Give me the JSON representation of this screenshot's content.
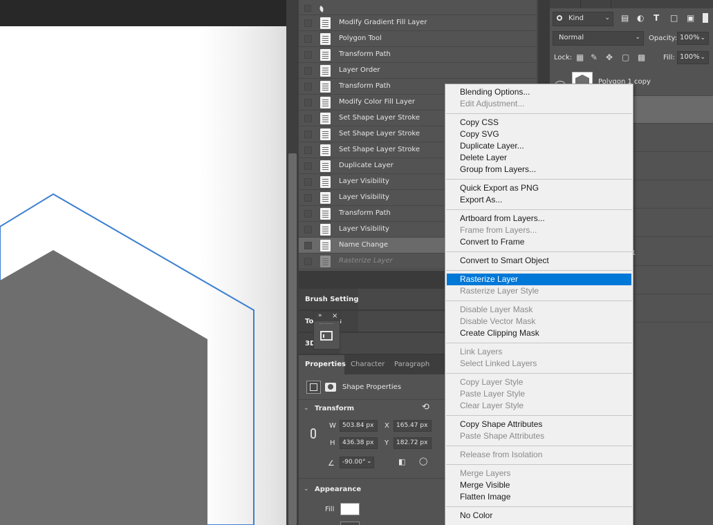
{
  "history": {
    "items": [
      {
        "label": "Modify Gradient Fill Layer"
      },
      {
        "label": "Polygon Tool"
      },
      {
        "label": "Transform Path"
      },
      {
        "label": "Layer Order"
      },
      {
        "label": "Transform Path"
      },
      {
        "label": "Modify Color Fill Layer"
      },
      {
        "label": "Set Shape Layer Stroke"
      },
      {
        "label": "Set Shape Layer Stroke"
      },
      {
        "label": "Set Shape Layer Stroke"
      },
      {
        "label": "Duplicate Layer"
      },
      {
        "label": "Layer Visibility"
      },
      {
        "label": "Layer Visibility"
      },
      {
        "label": "Transform Path"
      },
      {
        "label": "Layer Visibility"
      },
      {
        "label": "Name Change"
      },
      {
        "label": "Rasterize Layer"
      }
    ],
    "selected_index": 14,
    "undone_index": 15
  },
  "panels": {
    "brush_settings": "Brush Settings",
    "tool_presets_partial": "To",
    "tool_presets_tail": "s",
    "three_d": "3D"
  },
  "floating_panel": {
    "expand": "»",
    "close": "×"
  },
  "properties": {
    "tabs": [
      "Properties",
      "Character",
      "Paragraph"
    ],
    "active_tab": "Properties",
    "shape_label": "Shape Properties",
    "transform_title": "Transform",
    "w_label": "W",
    "w_value": "503.84 px",
    "x_label": "X",
    "x_value": "165.47 px",
    "h_label": "H",
    "h_value": "436.38 px",
    "y_label": "Y",
    "y_value": "182.72 px",
    "angle_value": "-90.00°",
    "appearance_title": "Appearance",
    "fill_label": "Fill",
    "fill_color": "#ffffff"
  },
  "layers": {
    "kind_label": "Kind",
    "blend_mode": "Normal",
    "opacity_label": "Opacity:",
    "opacity_value": "100%",
    "lock_label": "Lock:",
    "fill_label": "Fill:",
    "fill_value": "100%",
    "top_layer_name": "Polygon 1 copy",
    "partial_layer_text": "1"
  },
  "context_menu": {
    "groups": [
      [
        {
          "label": "Blending Options...",
          "enabled": true
        },
        {
          "label": "Edit Adjustment...",
          "enabled": false
        }
      ],
      [
        {
          "label": "Copy CSS",
          "enabled": true
        },
        {
          "label": "Copy SVG",
          "enabled": true
        },
        {
          "label": "Duplicate Layer...",
          "enabled": true
        },
        {
          "label": "Delete Layer",
          "enabled": true
        },
        {
          "label": "Group from Layers...",
          "enabled": true
        }
      ],
      [
        {
          "label": "Quick Export as PNG",
          "enabled": true
        },
        {
          "label": "Export As...",
          "enabled": true
        }
      ],
      [
        {
          "label": "Artboard from Layers...",
          "enabled": true
        },
        {
          "label": "Frame from Layers...",
          "enabled": false
        },
        {
          "label": "Convert to Frame",
          "enabled": true
        }
      ],
      [
        {
          "label": "Convert to Smart Object",
          "enabled": true
        }
      ],
      [
        {
          "label": "Rasterize Layer",
          "enabled": true,
          "highlighted": true
        },
        {
          "label": "Rasterize Layer Style",
          "enabled": false
        }
      ],
      [
        {
          "label": "Disable Layer Mask",
          "enabled": false
        },
        {
          "label": "Disable Vector Mask",
          "enabled": false
        },
        {
          "label": "Create Clipping Mask",
          "enabled": true
        }
      ],
      [
        {
          "label": "Link Layers",
          "enabled": false
        },
        {
          "label": "Select Linked Layers",
          "enabled": false
        }
      ],
      [
        {
          "label": "Copy Layer Style",
          "enabled": false
        },
        {
          "label": "Paste Layer Style",
          "enabled": false
        },
        {
          "label": "Clear Layer Style",
          "enabled": false
        }
      ],
      [
        {
          "label": "Copy Shape Attributes",
          "enabled": true
        },
        {
          "label": "Paste Shape Attributes",
          "enabled": false
        }
      ],
      [
        {
          "label": "Release from Isolation",
          "enabled": false
        }
      ],
      [
        {
          "label": "Merge Layers",
          "enabled": false
        },
        {
          "label": "Merge Visible",
          "enabled": true
        },
        {
          "label": "Flatten Image",
          "enabled": true
        }
      ],
      [
        {
          "label": "No Color",
          "enabled": true
        }
      ]
    ],
    "highlight_color": "#0078d7"
  },
  "colors": {
    "panel_bg": "#535353",
    "hexagon_outline": "#3b7fd1",
    "hexagon_fill": "#6e6e6e"
  }
}
